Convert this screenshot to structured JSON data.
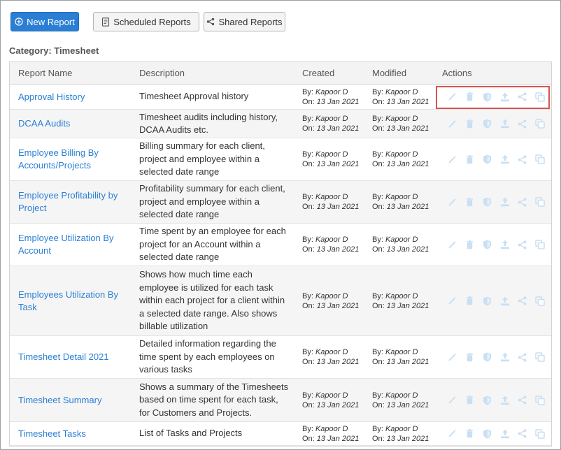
{
  "toolbar": {
    "new_report": "New Report",
    "scheduled_reports": "Scheduled Reports",
    "shared_reports": "Shared Reports"
  },
  "category": "Category: Timesheet",
  "table": {
    "headers": {
      "name": "Report Name",
      "description": "Description",
      "created": "Created",
      "modified": "Modified",
      "actions": "Actions"
    },
    "by_label": "By:",
    "on_label": "On:",
    "rows": [
      {
        "name_lines": [
          "Approval History"
        ],
        "desc_lines": [
          "Timesheet Approval history"
        ],
        "created_by": "Kapoor D",
        "created_on": "13 Jan 2021",
        "modified_by": "Kapoor D",
        "modified_on": "13 Jan 2021"
      },
      {
        "name_lines": [
          "DCAA Audits"
        ],
        "desc_lines": [
          "Timesheet audits including history,",
          "DCAA Audits etc."
        ],
        "created_by": "Kapoor D",
        "created_on": "13 Jan 2021",
        "modified_by": "Kapoor D",
        "modified_on": "13 Jan 2021"
      },
      {
        "name_lines": [
          "Employee Billing By",
          "Accounts/Projects"
        ],
        "desc_lines": [
          "Billing summary for each client,",
          "project and employee within a",
          "selected date range"
        ],
        "created_by": "Kapoor D",
        "created_on": "13 Jan 2021",
        "modified_by": "Kapoor D",
        "modified_on": "13 Jan 2021"
      },
      {
        "name_lines": [
          "Employee Profitability by",
          "Project"
        ],
        "desc_lines": [
          "Profitability summary for each client,",
          "project and employee within a",
          "selected date range"
        ],
        "created_by": "Kapoor D",
        "created_on": "13 Jan 2021",
        "modified_by": "Kapoor D",
        "modified_on": "13 Jan 2021"
      },
      {
        "name_lines": [
          "Employee Utilization By",
          "Account"
        ],
        "desc_lines": [
          "Time spent by an employee for each",
          "project for an Account within a",
          "selected date range"
        ],
        "created_by": "Kapoor D",
        "created_on": "13 Jan 2021",
        "modified_by": "Kapoor D",
        "modified_on": "13 Jan 2021"
      },
      {
        "name_lines": [
          "Employees Utilization By",
          "Task"
        ],
        "desc_lines": [
          "Shows how much time each",
          "employee is utilized for each task",
          "within each project for a client within",
          "a selected date range. Also shows",
          "billable utilization"
        ],
        "created_by": "Kapoor D",
        "created_on": "13 Jan 2021",
        "modified_by": "Kapoor D",
        "modified_on": "13 Jan 2021"
      },
      {
        "name_lines": [
          "Timesheet Detail 2021"
        ],
        "desc_lines": [
          "Detailed information regarding the",
          "time spent by each employees on",
          "various tasks"
        ],
        "created_by": "Kapoor D",
        "created_on": "13 Jan 2021",
        "modified_by": "Kapoor D",
        "modified_on": "13 Jan 2021"
      },
      {
        "name_lines": [
          "Timesheet Summary"
        ],
        "desc_lines": [
          "Shows a summary of the Timesheets",
          "based on time spent for each task,",
          "for Customers and Projects."
        ],
        "created_by": "Kapoor D",
        "created_on": "13 Jan 2021",
        "modified_by": "Kapoor D",
        "modified_on": "13 Jan 2021"
      },
      {
        "name_lines": [
          "Timesheet Tasks"
        ],
        "desc_lines": [
          "List of Tasks and Projects"
        ],
        "created_by": "Kapoor D",
        "created_on": "13 Jan 2021",
        "modified_by": "Kapoor D",
        "modified_on": "13 Jan 2021"
      }
    ],
    "action_icons": [
      "edit-icon",
      "delete-icon",
      "permissions-icon",
      "upload-icon",
      "share-icon",
      "copy-icon"
    ]
  },
  "colors": {
    "primary": "#2a7fd4",
    "link": "#2a7fd4",
    "action_icon": "#c9dff3",
    "highlight": "#d9534f"
  }
}
